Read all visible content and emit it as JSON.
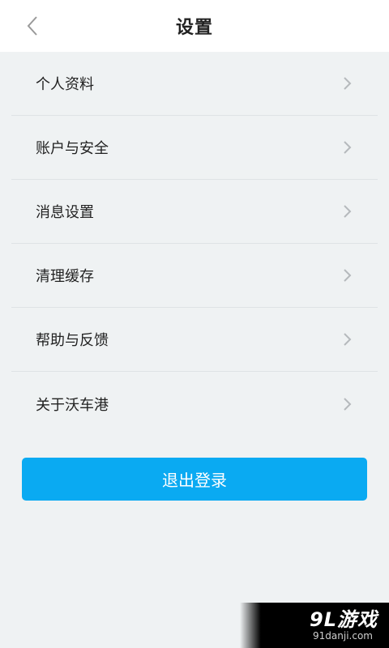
{
  "header": {
    "title": "设置"
  },
  "menu": {
    "items": [
      {
        "label": "个人资料"
      },
      {
        "label": "账户与安全"
      },
      {
        "label": "消息设置"
      },
      {
        "label": "清理缓存"
      },
      {
        "label": "帮助与反馈"
      },
      {
        "label": "关于沃车港"
      }
    ]
  },
  "logout": {
    "label": "退出登录"
  },
  "watermark": {
    "main": "9L游戏",
    "sub": "91danji.com"
  },
  "colors": {
    "accent": "#0aaaf2",
    "background": "#eff2f3",
    "header": "#ffffff"
  },
  "icons": {
    "back": "chevron-left-icon",
    "item_arrow": "chevron-right-icon"
  }
}
